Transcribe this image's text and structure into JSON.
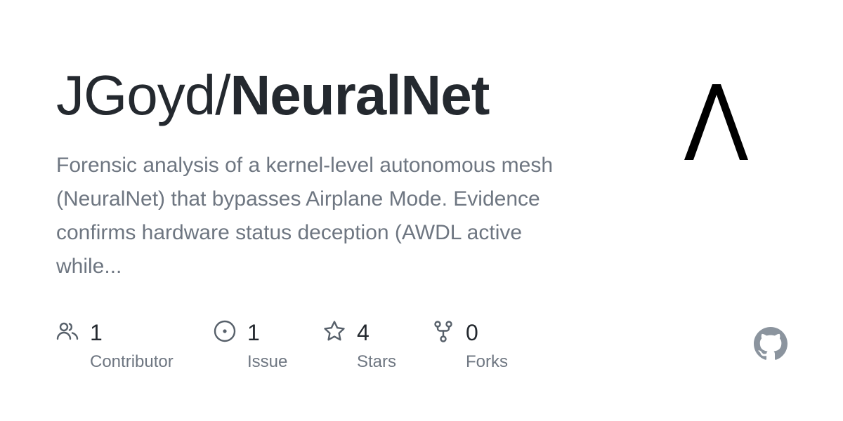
{
  "repo": {
    "owner": "JGoyd/",
    "name": "NeuralNet",
    "description": "Forensic analysis of a kernel-level autonomous mesh (NeuralNet) that bypasses Airplane Mode. Evidence confirms hardware status deception (AWDL active while..."
  },
  "stats": [
    {
      "icon": "people-icon",
      "count": "1",
      "label": "Contributor"
    },
    {
      "icon": "issue-opened-icon",
      "count": "1",
      "label": "Issue"
    },
    {
      "icon": "star-icon",
      "count": "4",
      "label": "Stars"
    },
    {
      "icon": "repo-forked-icon",
      "count": "0",
      "label": "Forks"
    }
  ],
  "colors": {
    "title": "#24292f",
    "muted": "#6e7681",
    "icon": "#57606a",
    "github_mark": "#8b949e"
  },
  "icons": {
    "avatar": "lambda-logo",
    "brand": "github-mark-icon"
  }
}
